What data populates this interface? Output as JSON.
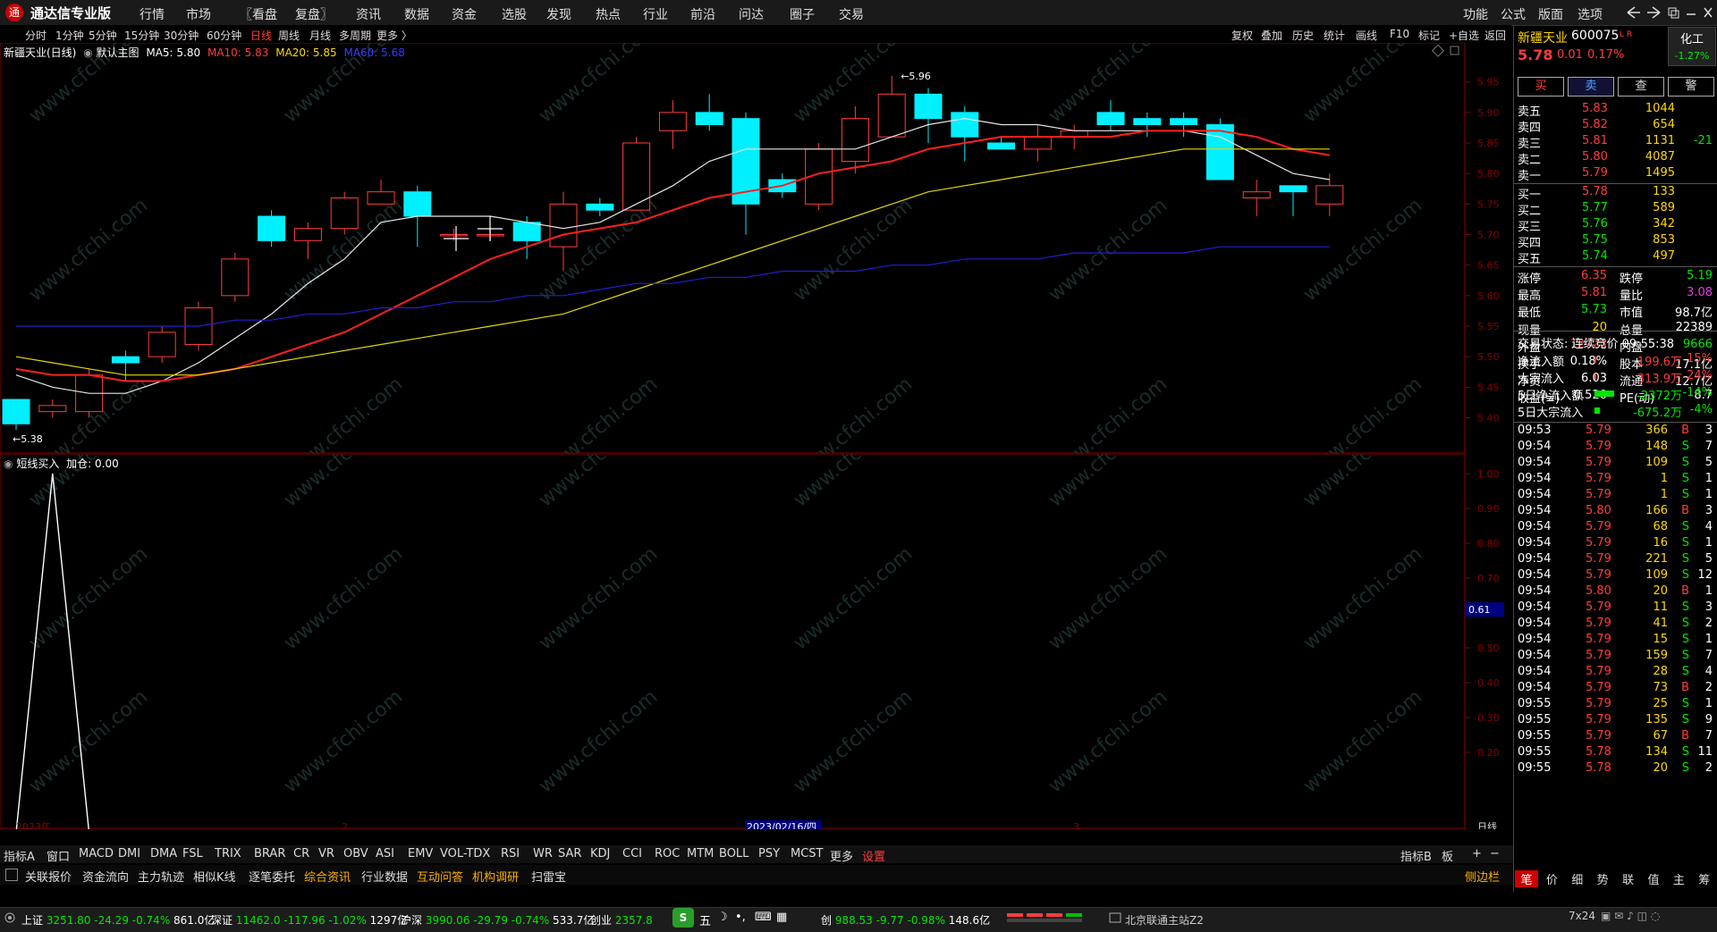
{
  "app": {
    "name": "通达信专业版",
    "logo_glyph": "通"
  },
  "top_menu": [
    "行情",
    "市场",
    "〖看盘",
    "复盘〗",
    "资讯",
    "数据",
    "资金",
    "选股",
    "发现",
    "热点",
    "行业",
    "前沿",
    "问达",
    "圈子",
    "交易"
  ],
  "top_right_menu": [
    "功能",
    "公式",
    "版面",
    "选项"
  ],
  "window_icons": [
    "back-icon",
    "forward-icon",
    "restore-icon",
    "minimize-icon",
    "maximize-icon",
    "close-icon"
  ],
  "periods": [
    "分时",
    "1分钟",
    "5分钟",
    "15分钟",
    "30分钟",
    "60分钟",
    "日线",
    "周线",
    "月线",
    "多周期",
    "更多 〉"
  ],
  "active_period": "日线",
  "chart_tools": [
    "复权",
    "叠加",
    "历史",
    "统计",
    "画线",
    "F10",
    "标记",
    "+自选",
    "返回"
  ],
  "main_legend": {
    "title": "新疆天业(日线)",
    "template": "默认主图",
    "ma5": "MA5: 5.80",
    "ma10": "MA10: 5.83",
    "ma20": "MA20: 5.85",
    "ma60": "MA60: 5.68"
  },
  "sub_legend": {
    "title": "短线买入",
    "value": "加仓: 0.00"
  },
  "price_axis": [
    "5.95",
    "5.90",
    "5.85",
    "5.80",
    "5.75",
    "5.70",
    "5.65",
    "5.60",
    "5.55",
    "5.50",
    "5.45",
    "5.40"
  ],
  "sub_axis": [
    "1.00",
    "0.90",
    "0.80",
    "0.70",
    "0.61",
    "0.50",
    "0.40",
    "0.30",
    "0.20"
  ],
  "highlight_value": "0.61",
  "high_mark": "5.96",
  "low_mark": "5.38",
  "x_labels": [
    "2023年",
    "2",
    "2023/02/16/四",
    "3"
  ],
  "x_period_label": "日线",
  "chart_data": {
    "type": "candlestick",
    "title": "新疆天业(日线)",
    "ylim": [
      5.37,
      5.97
    ],
    "candles": [
      {
        "o": 5.43,
        "h": 5.43,
        "l": 5.38,
        "c": 5.39
      },
      {
        "o": 5.41,
        "h": 5.43,
        "l": 5.4,
        "c": 5.42
      },
      {
        "o": 5.41,
        "h": 5.48,
        "l": 5.4,
        "c": 5.47
      },
      {
        "o": 5.5,
        "h": 5.51,
        "l": 5.46,
        "c": 5.49
      },
      {
        "o": 5.5,
        "h": 5.55,
        "l": 5.49,
        "c": 5.54
      },
      {
        "o": 5.52,
        "h": 5.59,
        "l": 5.51,
        "c": 5.58
      },
      {
        "o": 5.6,
        "h": 5.67,
        "l": 5.59,
        "c": 5.66
      },
      {
        "o": 5.73,
        "h": 5.74,
        "l": 5.68,
        "c": 5.69
      },
      {
        "o": 5.69,
        "h": 5.72,
        "l": 5.66,
        "c": 5.71
      },
      {
        "o": 5.71,
        "h": 5.77,
        "l": 5.7,
        "c": 5.76
      },
      {
        "o": 5.75,
        "h": 5.79,
        "l": 5.75,
        "c": 5.77
      },
      {
        "o": 5.77,
        "h": 5.78,
        "l": 5.68,
        "c": 5.73
      },
      {
        "o": 5.7,
        "h": 5.71,
        "l": 5.69,
        "c": 5.7
      },
      {
        "o": 5.7,
        "h": 5.71,
        "l": 5.69,
        "c": 5.7
      },
      {
        "o": 5.72,
        "h": 5.73,
        "l": 5.66,
        "c": 5.69
      },
      {
        "o": 5.68,
        "h": 5.77,
        "l": 5.64,
        "c": 5.75
      },
      {
        "o": 5.75,
        "h": 5.76,
        "l": 5.73,
        "c": 5.74
      },
      {
        "o": 5.74,
        "h": 5.86,
        "l": 5.74,
        "c": 5.85
      },
      {
        "o": 5.87,
        "h": 5.92,
        "l": 5.84,
        "c": 5.9
      },
      {
        "o": 5.9,
        "h": 5.93,
        "l": 5.87,
        "c": 5.88
      },
      {
        "o": 5.89,
        "h": 5.9,
        "l": 5.7,
        "c": 5.75
      },
      {
        "o": 5.79,
        "h": 5.8,
        "l": 5.76,
        "c": 5.77
      },
      {
        "o": 5.75,
        "h": 5.85,
        "l": 5.74,
        "c": 5.84
      },
      {
        "o": 5.82,
        "h": 5.91,
        "l": 5.8,
        "c": 5.89
      },
      {
        "o": 5.86,
        "h": 5.96,
        "l": 5.86,
        "c": 5.93
      },
      {
        "o": 5.93,
        "h": 5.94,
        "l": 5.85,
        "c": 5.89
      },
      {
        "o": 5.9,
        "h": 5.91,
        "l": 5.82,
        "c": 5.86
      },
      {
        "o": 5.85,
        "h": 5.86,
        "l": 5.84,
        "c": 5.84
      },
      {
        "o": 5.84,
        "h": 5.88,
        "l": 5.82,
        "c": 5.86
      },
      {
        "o": 5.86,
        "h": 5.88,
        "l": 5.84,
        "c": 5.87
      },
      {
        "o": 5.9,
        "h": 5.92,
        "l": 5.87,
        "c": 5.88
      },
      {
        "o": 5.89,
        "h": 5.9,
        "l": 5.86,
        "c": 5.88
      },
      {
        "o": 5.89,
        "h": 5.9,
        "l": 5.86,
        "c": 5.88
      },
      {
        "o": 5.88,
        "h": 5.89,
        "l": 5.79,
        "c": 5.79
      },
      {
        "o": 5.76,
        "h": 5.79,
        "l": 5.73,
        "c": 5.77
      },
      {
        "o": 5.78,
        "h": 5.78,
        "l": 5.73,
        "c": 5.77
      },
      {
        "o": 5.75,
        "h": 5.8,
        "l": 5.73,
        "c": 5.78
      }
    ],
    "series": [
      {
        "name": "MA5",
        "color": "#e6e6e6",
        "values": [
          5.47,
          5.45,
          5.44,
          5.44,
          5.46,
          5.49,
          5.53,
          5.57,
          5.62,
          5.66,
          5.72,
          5.73,
          5.73,
          5.73,
          5.72,
          5.71,
          5.72,
          5.75,
          5.78,
          5.82,
          5.84,
          5.84,
          5.84,
          5.84,
          5.86,
          5.88,
          5.89,
          5.88,
          5.88,
          5.87,
          5.87,
          5.87,
          5.87,
          5.86,
          5.83,
          5.8,
          5.79
        ]
      },
      {
        "name": "MA10",
        "color": "#ff2020",
        "values": [
          5.48,
          5.47,
          5.47,
          5.46,
          5.46,
          5.47,
          5.48,
          5.5,
          5.52,
          5.54,
          5.57,
          5.6,
          5.63,
          5.66,
          5.68,
          5.7,
          5.71,
          5.72,
          5.74,
          5.76,
          5.77,
          5.78,
          5.8,
          5.81,
          5.82,
          5.84,
          5.85,
          5.86,
          5.86,
          5.86,
          5.86,
          5.87,
          5.87,
          5.87,
          5.86,
          5.84,
          5.83
        ]
      },
      {
        "name": "MA20",
        "color": "#e6d800",
        "values": [
          5.5,
          5.49,
          5.48,
          5.47,
          5.47,
          5.47,
          5.48,
          5.49,
          5.5,
          5.51,
          5.52,
          5.53,
          5.54,
          5.55,
          5.56,
          5.57,
          5.59,
          5.61,
          5.63,
          5.65,
          5.67,
          5.69,
          5.71,
          5.73,
          5.75,
          5.77,
          5.78,
          5.79,
          5.8,
          5.81,
          5.82,
          5.83,
          5.84,
          5.84,
          5.84,
          5.84,
          5.84
        ]
      },
      {
        "name": "MA60",
        "color": "#2020d0",
        "values": [
          5.55,
          5.55,
          5.55,
          5.55,
          5.55,
          5.55,
          5.56,
          5.56,
          5.57,
          5.57,
          5.58,
          5.58,
          5.59,
          5.59,
          5.6,
          5.6,
          5.61,
          5.62,
          5.62,
          5.63,
          5.63,
          5.64,
          5.64,
          5.64,
          5.65,
          5.65,
          5.66,
          5.66,
          5.66,
          5.67,
          5.67,
          5.67,
          5.67,
          5.68,
          5.68,
          5.68,
          5.68
        ]
      }
    ],
    "indicator": {
      "name": "短线买入",
      "ylim": [
        0,
        1.05
      ],
      "values": [
        0,
        1,
        0,
        0,
        0,
        0,
        0,
        0,
        0,
        0,
        0,
        0,
        0,
        0,
        0,
        0,
        0,
        0,
        0,
        0,
        0,
        0,
        0,
        0,
        0,
        0,
        0,
        0,
        0,
        0,
        0,
        0,
        0,
        0,
        0,
        0,
        0
      ]
    }
  },
  "quote": {
    "name": "新疆天业",
    "code": "600075",
    "tag": "L R",
    "sector": "化工",
    "sector_change": "-1.27%",
    "price": "5.78",
    "change": "0.01",
    "change_pct": "0.17%",
    "buttons": [
      "买",
      "卖",
      "查",
      "警"
    ],
    "asks": [
      {
        "label": "卖五",
        "price": "5.83",
        "vol": "1044",
        "extra": ""
      },
      {
        "label": "卖四",
        "price": "5.82",
        "vol": "654",
        "extra": ""
      },
      {
        "label": "卖三",
        "price": "5.81",
        "vol": "1131",
        "extra": "-21"
      },
      {
        "label": "卖二",
        "price": "5.80",
        "vol": "4087",
        "extra": ""
      },
      {
        "label": "卖一",
        "price": "5.79",
        "vol": "1495",
        "extra": ""
      }
    ],
    "bids": [
      {
        "label": "买一",
        "price": "5.78",
        "vol": "133"
      },
      {
        "label": "买二",
        "price": "5.77",
        "vol": "589"
      },
      {
        "label": "买三",
        "price": "5.76",
        "vol": "342"
      },
      {
        "label": "买四",
        "price": "5.75",
        "vol": "853"
      },
      {
        "label": "买五",
        "price": "5.74",
        "vol": "497"
      }
    ],
    "stats": [
      {
        "l1": "涨停",
        "v1": "6.35",
        "c1": "red",
        "l2": "跌停",
        "v2": "5.19",
        "c2": "green"
      },
      {
        "l1": "最高",
        "v1": "5.81",
        "c1": "red",
        "l2": "量比",
        "v2": "3.08",
        "c2": "magenta"
      },
      {
        "l1": "最低",
        "v1": "5.73",
        "c1": "green",
        "l2": "市值",
        "v2": "98.7亿",
        "c2": "white"
      },
      {
        "l1": "现量",
        "v1": "20",
        "c1": "yellow",
        "l2": "总量",
        "v2": "22389",
        "c2": "white"
      },
      {
        "l1": "外盘",
        "v1": "12723",
        "c1": "red",
        "l2": "内盘",
        "v2": "9666",
        "c2": "green"
      },
      {
        "l1": "换手",
        "v1": "0.18%",
        "c1": "white",
        "l2": "股本",
        "v2": "17.1亿",
        "c2": "white"
      },
      {
        "l1": "净资",
        "v1": "6.03",
        "c1": "white",
        "l2": "流通",
        "v2": "12.7亿",
        "c2": "white"
      },
      {
        "l1": "收益(≡)",
        "v1": "0.520",
        "c1": "white",
        "l2": "PE(动)",
        "v2": "8.7",
        "c2": "white"
      }
    ],
    "trade_status": "交易状态: 连续竞价 09:55:38",
    "flows": [
      {
        "label": "净流入额",
        "value": "199.6万",
        "pct": "15%",
        "color": "red"
      },
      {
        "label": "大宗流入",
        "value": "313.9万",
        "pct": "24%",
        "color": "red"
      },
      {
        "label": "5日净流入额",
        "value": "-2372万",
        "pct": "-14%",
        "color": "green"
      },
      {
        "label": "5日大宗流入",
        "value": "-675.2万",
        "pct": "-4%",
        "color": "green"
      }
    ],
    "ticks": [
      [
        "09:53",
        "5.79",
        "366",
        "B",
        "3"
      ],
      [
        "09:54",
        "5.79",
        "148",
        "S",
        "7"
      ],
      [
        "09:54",
        "5.79",
        "109",
        "S",
        "5"
      ],
      [
        "09:54",
        "5.79",
        "1",
        "S",
        "1"
      ],
      [
        "09:54",
        "5.79",
        "1",
        "S",
        "1"
      ],
      [
        "09:54",
        "5.80",
        "166",
        "B",
        "3"
      ],
      [
        "09:54",
        "5.79",
        "68",
        "S",
        "4"
      ],
      [
        "09:54",
        "5.79",
        "16",
        "S",
        "1"
      ],
      [
        "09:54",
        "5.79",
        "221",
        "S",
        "5"
      ],
      [
        "09:54",
        "5.79",
        "109",
        "S",
        "12"
      ],
      [
        "09:54",
        "5.80",
        "20",
        "B",
        "1"
      ],
      [
        "09:54",
        "5.79",
        "11",
        "S",
        "3"
      ],
      [
        "09:54",
        "5.79",
        "41",
        "S",
        "2"
      ],
      [
        "09:54",
        "5.79",
        "15",
        "S",
        "1"
      ],
      [
        "09:54",
        "5.79",
        "159",
        "S",
        "7"
      ],
      [
        "09:54",
        "5.79",
        "28",
        "S",
        "4"
      ],
      [
        "09:54",
        "5.79",
        "73",
        "B",
        "2"
      ],
      [
        "09:55",
        "5.79",
        "25",
        "S",
        "1"
      ],
      [
        "09:55",
        "5.79",
        "135",
        "S",
        "9"
      ],
      [
        "09:55",
        "5.79",
        "67",
        "B",
        "7"
      ],
      [
        "09:55",
        "5.78",
        "134",
        "S",
        "11"
      ],
      [
        "09:55",
        "5.78",
        "20",
        "S",
        "2"
      ]
    ],
    "tabs": [
      "笔",
      "价",
      "细",
      "势",
      "联",
      "值",
      "主",
      "筹"
    ]
  },
  "indicator_tabs": [
    "指标A",
    "窗口",
    "MACD",
    "DMI",
    "DMA",
    "FSL",
    "TRIX",
    "BRAR",
    "CR",
    "VR",
    "OBV",
    "ASI",
    "EMV",
    "VOL-TDX",
    "RSI",
    "WR",
    "SAR",
    "KDJ",
    "CCI",
    "ROC",
    "MTM",
    "BOLL",
    "PSY",
    "MCST",
    "更多",
    "设置"
  ],
  "indicator_right": [
    "指标B",
    "板",
    "+",
    "−"
  ],
  "func_tabs": [
    {
      "label": "关联报价",
      "color": "#ddd"
    },
    {
      "label": "资金流向",
      "color": "#ddd"
    },
    {
      "label": "主力轨迹",
      "color": "#ddd"
    },
    {
      "label": "相似K线",
      "color": "#ddd"
    },
    {
      "label": "逐笔委托",
      "color": "#ddd"
    },
    {
      "label": "综合资讯",
      "color": "#ffb000"
    },
    {
      "label": "行业数据",
      "color": "#ddd"
    },
    {
      "label": "互动问答",
      "color": "#ffb000"
    },
    {
      "label": "机构调研",
      "color": "#ffb000"
    },
    {
      "label": "扫雷宝",
      "color": "#ddd"
    }
  ],
  "sidebar_toggle": "侧边栏",
  "status_indices": [
    {
      "name": "上证",
      "val": "3251.80",
      "chg": "-24.29",
      "pct": "-0.74%",
      "amt": "861.0亿"
    },
    {
      "name": "深证",
      "val": "11462.0",
      "chg": "-117.96",
      "pct": "-1.02%",
      "amt": "1297亿"
    },
    {
      "name": "沪深",
      "val": "3990.06",
      "chg": "-29.79",
      "pct": "-0.74%",
      "amt": "533.7亿"
    },
    {
      "name": "创业",
      "val": "2357.8",
      "chg": "",
      "pct": "",
      "amt": ""
    }
  ],
  "status_extra": {
    "prefix": "创",
    "val": "988.53",
    "chg": "-9.77",
    "pct": "-0.98%",
    "amt": "148.6亿"
  },
  "ime": {
    "logo": "S",
    "label": "五"
  },
  "server": "北京联通主站Z2",
  "session": "7x24",
  "watermark": "www.cfchi.com"
}
